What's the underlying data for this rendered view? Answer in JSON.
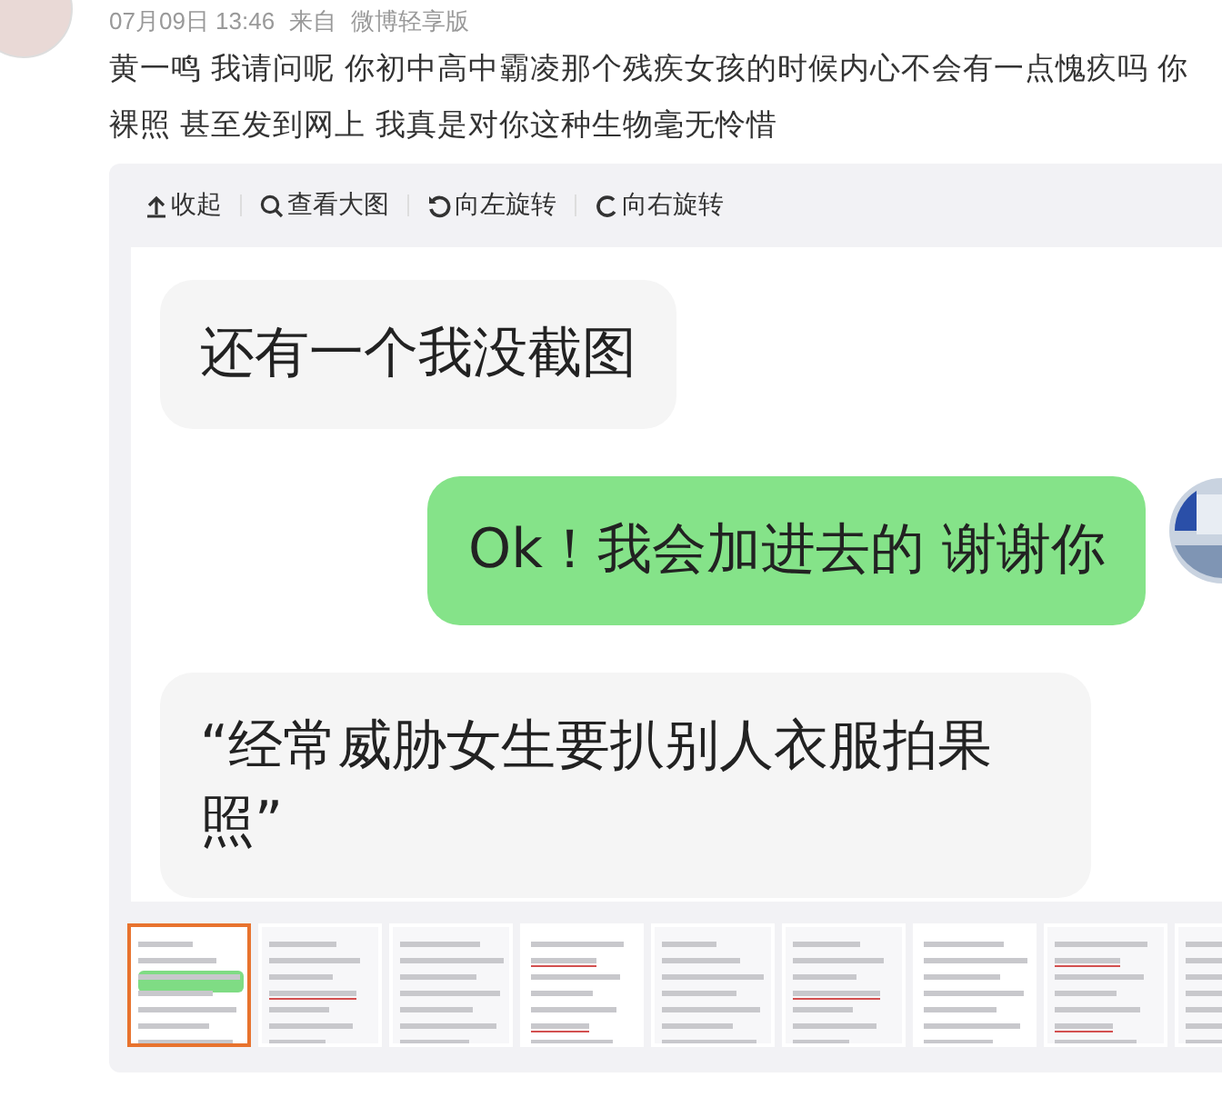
{
  "post": {
    "time": "07月09日 13:46",
    "source_prefix": "来自",
    "source": "微博轻享版",
    "text_lines": [
      "黄一鸣 我请问呢 你初中高中霸凌那个残疾女孩的时候内心不会有一点愧疚吗 你",
      "裸照 甚至发到网上 我真是对你这种生物毫无怜惜"
    ]
  },
  "toolbar": [
    {
      "kind": "collapse",
      "label": "收起"
    },
    {
      "kind": "view",
      "label": "查看大图"
    },
    {
      "kind": "rotate_left",
      "label": "向左旋转"
    },
    {
      "kind": "rotate_right",
      "label": "向右旋转"
    }
  ],
  "chat": [
    {
      "kind": "incoming",
      "text": "还有一个我没截图"
    },
    {
      "kind": "outgoing",
      "text": "Ok！我会加进去的 谢谢你"
    },
    {
      "kind": "incoming",
      "text": "“经常威胁女生要扒别人衣服拍果照”"
    }
  ],
  "thumbnails": [
    {
      "kind": "picture",
      "selected": true
    },
    {
      "kind": "picture",
      "selected": false
    },
    {
      "kind": "picture",
      "selected": false
    },
    {
      "kind": "picture",
      "selected": false
    },
    {
      "kind": "picture",
      "selected": false
    },
    {
      "kind": "picture",
      "selected": false
    },
    {
      "kind": "picture",
      "selected": false
    },
    {
      "kind": "picture",
      "selected": false
    },
    {
      "kind": "picture",
      "selected": false
    }
  ]
}
